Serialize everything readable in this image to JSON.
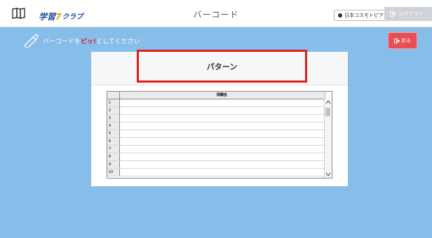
{
  "header": {
    "title": "バーコード",
    "logo": {
      "part1": "学習",
      "part2": "7",
      "part3": "クラブ"
    },
    "company_button": "日本コスモトピア",
    "logout_label": "ログアウト"
  },
  "instruction": {
    "prefix": "バーコードを ",
    "highlight": "ピッ!",
    "suffix": " としてください"
  },
  "back_button": "戻る",
  "pattern_label": "パターン",
  "table": {
    "column_header": "問題名",
    "rows": [
      "1",
      "2",
      "3",
      "4",
      "5",
      "6",
      "7",
      "8",
      "9",
      "10"
    ]
  },
  "colors": {
    "background": "#87bde9",
    "back_button": "#e84f55",
    "highlight": "#e8192c",
    "annotation_border": "#e21b1b"
  },
  "icons": [
    "book-icon",
    "scanner-icon",
    "logout-icon",
    "back-icon",
    "scroll-up-icon",
    "scroll-down-icon"
  ]
}
